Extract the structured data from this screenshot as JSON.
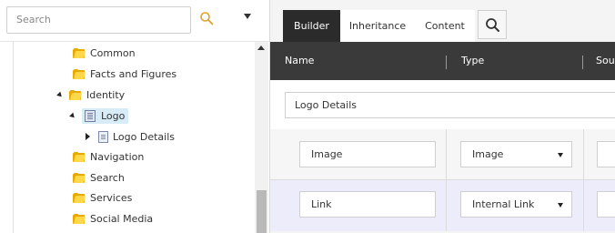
{
  "search": {
    "placeholder": "Search"
  },
  "tree": {
    "items": [
      {
        "label": "Common"
      },
      {
        "label": "Facts and Figures"
      },
      {
        "label": "Identity"
      },
      {
        "label": "Logo"
      },
      {
        "label": "Logo Details"
      },
      {
        "label": "Navigation"
      },
      {
        "label": "Search"
      },
      {
        "label": "Services"
      },
      {
        "label": "Social Media"
      }
    ]
  },
  "tabs": {
    "builder": "Builder",
    "inheritance": "Inheritance",
    "content": "Content"
  },
  "table": {
    "headers": {
      "name": "Name",
      "type": "Type",
      "source": "Sour"
    },
    "section_name": "Logo Details",
    "fields": [
      {
        "name": "Image",
        "type": "Image"
      },
      {
        "name": "Link",
        "type": "Internal Link"
      }
    ]
  },
  "colors": {
    "active_tab": "#2b2b2b",
    "header": "#3a3a3a",
    "selected_row": "#ececfa",
    "folder": "#ffd84a"
  }
}
